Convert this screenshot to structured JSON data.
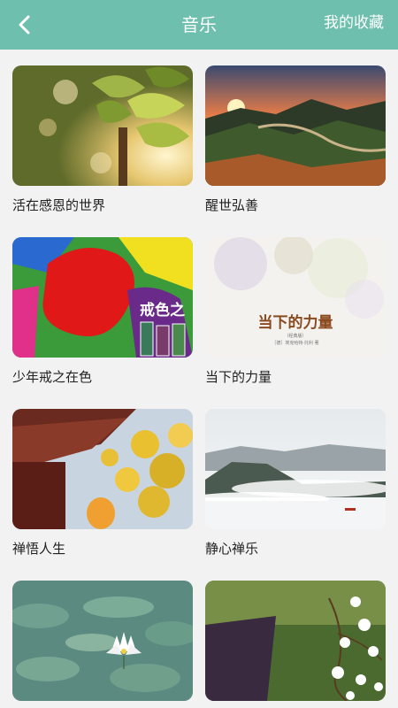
{
  "header": {
    "back_icon": "chevron-left-icon",
    "title": "音乐",
    "favorites_label": "我的收藏",
    "bg_color": "#6fbfae"
  },
  "albums": [
    {
      "title": "活在感恩的世界",
      "image": "sunlit ginkgo leaves"
    },
    {
      "title": "醒世弘善",
      "image": "sunset over great wall mountains"
    },
    {
      "title": "少年戒之在色",
      "image": "colorful paint splash",
      "cover_text": "戒色之"
    },
    {
      "title": "当下的力量",
      "image": "book cover",
      "cover_text": "当下的力量",
      "cover_sub1": "（经典版）",
      "cover_sub2": "［德］埃克哈特·托利 著"
    },
    {
      "title": "禅悟人生",
      "image": "temple eaves with yellow ginkgo"
    },
    {
      "title": "静心禅乐",
      "image": "misty mountains and clouds"
    },
    {
      "title": "",
      "image": "lotus leaves with white water lily"
    },
    {
      "title": "",
      "image": "white plum blossoms"
    }
  ]
}
